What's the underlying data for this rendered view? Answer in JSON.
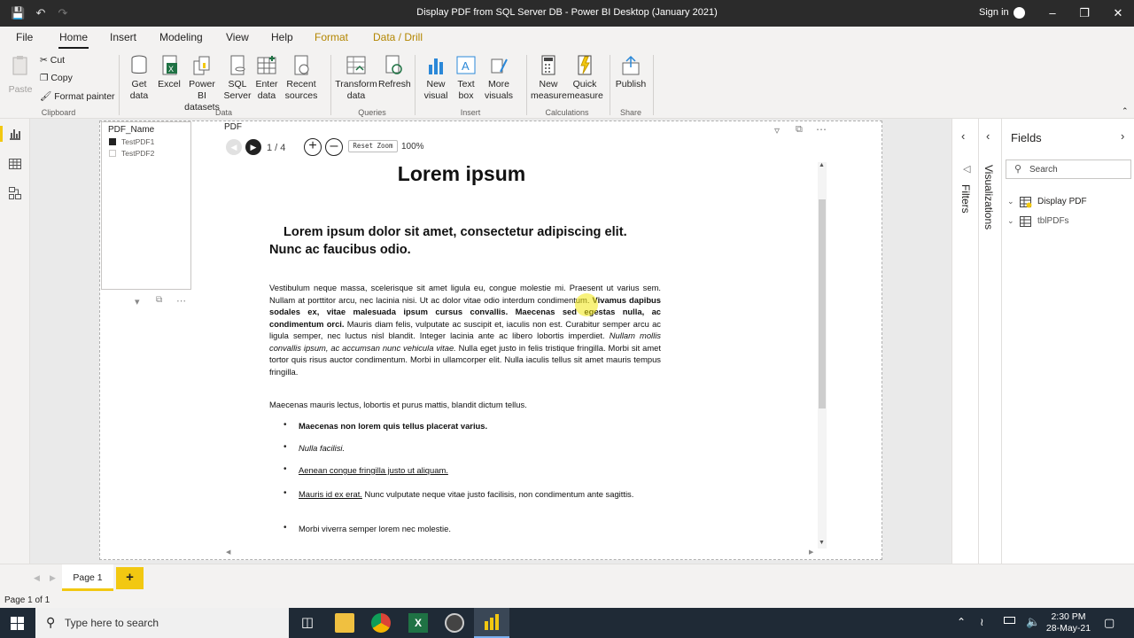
{
  "window": {
    "title": "Display PDF from SQL Server DB - Power BI Desktop (January 2021)",
    "sign_in": "Sign in"
  },
  "tabs": [
    {
      "label": "File"
    },
    {
      "label": "Home"
    },
    {
      "label": "Insert"
    },
    {
      "label": "Modeling"
    },
    {
      "label": "View"
    },
    {
      "label": "Help"
    },
    {
      "label": "Format"
    },
    {
      "label": "Data / Drill"
    }
  ],
  "ribbon": {
    "paste": "Paste",
    "cut": "Cut",
    "copy": "Copy",
    "format_painter": "Format painter",
    "get_data": "Get data",
    "excel": "Excel",
    "pbi_datasets": "Power BI datasets",
    "sql_server": "SQL Server",
    "enter_data": "Enter data",
    "recent_sources": "Recent sources",
    "transform_data": "Transform data",
    "refresh": "Refresh",
    "new_visual": "New visual",
    "text_box": "Text box",
    "more_visuals": "More visuals",
    "new_measure": "New measure",
    "quick_measure": "Quick measure",
    "publish": "Publish",
    "groups": {
      "clipboard": "Clipboard",
      "data": "Data",
      "queries": "Queries",
      "insert": "Insert",
      "calculations": "Calculations",
      "share": "Share"
    }
  },
  "slicer": {
    "title": "PDF_Name",
    "items": [
      {
        "label": "TestPDF1",
        "checked": true
      },
      {
        "label": "TestPDF2",
        "checked": false
      }
    ]
  },
  "pdf": {
    "title": "PDF",
    "page_indicator": "1 / 4",
    "reset_zoom": "Reset Zoom",
    "zoom": "100%",
    "doc_title": "Lorem ipsum",
    "heading": "Lorem ipsum dolor sit amet, consectetur adipiscing elit. Nunc ac faucibus odio.",
    "p1a": "Vestibulum neque massa, scelerisque sit amet ligula eu, congue molestie mi. Praesent ut varius sem. Nullam at porttitor arcu, nec lacinia nisi. Ut ac dolor vitae odio interdum condimentum. ",
    "p1b": "Vivamus dapibus sodales ex, vitae malesuada ipsum cursus convallis. Maecenas sed egestas nulla, ac condimentum orci.",
    "p1c": " Mauris diam felis, vulputate ac suscipit et, iaculis non est. Curabitur semper arcu ac ligula semper, nec luctus nisl blandit. Integer lacinia ante ac libero lobortis imperdiet. ",
    "p1d": "Nullam mollis convallis ipsum, ac accumsan nunc vehicula vitae.",
    "p1e": " Nulla eget justo in felis tristique fringilla. Morbi sit amet tortor quis risus auctor condimentum. Morbi in ullamcorper elit. Nulla iaculis tellus sit amet mauris tempus fringilla.",
    "p2": "Maecenas mauris lectus, lobortis et purus mattis, blandit dictum tellus.",
    "b1": "Maecenas non lorem quis tellus placerat varius.",
    "b2": "Nulla facilisi.",
    "b3": "Aenean congue fringilla justo ut aliquam.",
    "b4a": "Mauris id ex erat.",
    "b4b": " Nunc vulputate neque vitae justo facilisis, non condimentum ante sagittis.",
    "b5": "Morbi viverra semper lorem nec molestie."
  },
  "panes": {
    "filters": "Filters",
    "visualizations": "Visualizations",
    "fields": "Fields",
    "search_placeholder": "Search",
    "field_items": [
      "Display PDF",
      "tblPDFs"
    ]
  },
  "page_tabs": {
    "pages": [
      "Page 1"
    ],
    "add": "+"
  },
  "status": {
    "page_of": "Page 1 of 1"
  },
  "taskbar": {
    "search_placeholder": "Type here to search",
    "time": "2:30 PM",
    "date": "28-May-21"
  },
  "colors": {
    "accent_yellow": "#f2c811",
    "title_bar": "#2b2b2b",
    "taskbar": "#1f2a36"
  }
}
